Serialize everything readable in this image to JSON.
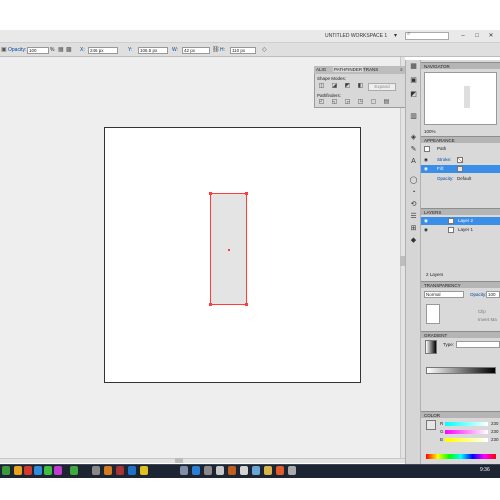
{
  "workspace": {
    "title": "UNTITLED WORKSPACE 1",
    "arrow": "▾",
    "search_icon": "search-icon"
  },
  "control_bar": {
    "opacity_label": "Opacity:",
    "opacity_value": "100",
    "percent": "%",
    "x_label": "X:",
    "x_value": "246 px",
    "y_label": "Y:",
    "y_value": "106.5 px",
    "w_label": "W:",
    "w_value": "42 px",
    "h_label": "H:",
    "h_value": "110 px"
  },
  "pathfinder": {
    "tabs": [
      "ALIG",
      "PATHFINDER",
      "TRANS"
    ],
    "shape_modes": "Shape Modes:",
    "pathfinders": "Pathfinders:",
    "expand": "Expand"
  },
  "navigator": {
    "title": "NAVIGATOR",
    "zoom": "100%"
  },
  "appearance": {
    "title": "APPEARANCE",
    "path": "Path",
    "stroke": "Stroke:",
    "fill": "Fill:",
    "opacity": "Opacity:",
    "opacity_value": "Default"
  },
  "layers": {
    "title": "LAYERS",
    "rows": [
      "Layer 2",
      "Layer 1"
    ],
    "count": "2 Layers"
  },
  "transparency": {
    "title": "TRANSPARENCY",
    "mode": "Normal",
    "opacity_label": "Opacity:",
    "opacity_value": "100",
    "clip": "Clip",
    "invert": "Invert Ma"
  },
  "gradient": {
    "title": "GRADIENT",
    "type": "Type:"
  },
  "color": {
    "title": "COLOR",
    "r": "R",
    "g": "G",
    "b": "B",
    "r_value": "230",
    "g_value": "230",
    "b_value": "230"
  },
  "taskbar": {
    "clock": "9:36"
  },
  "colors": {
    "selection": "#ff3b3b",
    "highlight": "#3b8ee8",
    "taskbar": "#1d2533"
  }
}
